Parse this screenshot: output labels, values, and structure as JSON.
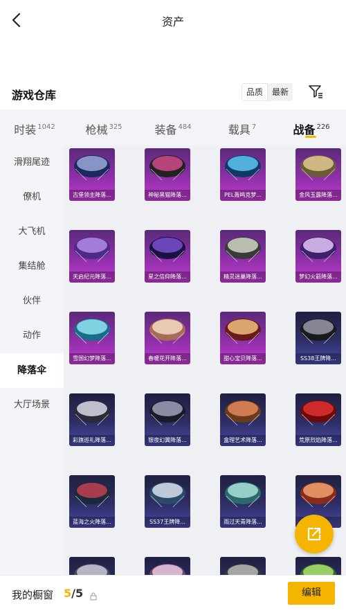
{
  "header": {
    "title": "资产"
  },
  "warehouse": {
    "title": "游戏仓库",
    "sort_quality": "品质",
    "sort_newest": "最新"
  },
  "tabs": [
    {
      "label": "时装",
      "count": "1042"
    },
    {
      "label": "枪械",
      "count": "325"
    },
    {
      "label": "装备",
      "count": "484"
    },
    {
      "label": "载具",
      "count": "7"
    },
    {
      "label": "战备",
      "count": "226"
    }
  ],
  "active_tab": "战备",
  "sidebar": [
    {
      "label": "滑翔尾迹"
    },
    {
      "label": "僚机"
    },
    {
      "label": "大飞机"
    },
    {
      "label": "集结舱"
    },
    {
      "label": "伙伴"
    },
    {
      "label": "动作"
    },
    {
      "label": "降落伞"
    },
    {
      "label": "大厅场景"
    }
  ],
  "active_sidebar": "降落伞",
  "items": [
    {
      "name": "古堡领主降落..."
    },
    {
      "name": "神秘黑猫降落..."
    },
    {
      "name": "PEL轰鸣克梦..."
    },
    {
      "name": "金风玉露降落..."
    },
    {
      "name": "天启纪元降落..."
    },
    {
      "name": "星之信仰降落..."
    },
    {
      "name": "精灵迷巢降落..."
    },
    {
      "name": "梦幻火箭降落..."
    },
    {
      "name": "雪国幻梦降落..."
    },
    {
      "name": "春暖花开降落..."
    },
    {
      "name": "甜心宝贝降落..."
    },
    {
      "name": "SS38王牌降..."
    },
    {
      "name": "彩旗巡礼降落..."
    },
    {
      "name": "银夜幻翼降落..."
    },
    {
      "name": "盒理艺术降落..."
    },
    {
      "name": "荒原烈焰降落..."
    },
    {
      "name": "蓝海之火降落..."
    },
    {
      "name": "SS37王牌降..."
    },
    {
      "name": "雨过天青降落..."
    },
    {
      "name": ""
    },
    {
      "name": ""
    },
    {
      "name": ""
    },
    {
      "name": ""
    },
    {
      "name": ""
    }
  ],
  "colors": {
    "accent": "#f5b400",
    "rarity_purple": "#9b2fb5",
    "rarity_blue": "#3b3b8c"
  },
  "bottom": {
    "label": "我的橱窗",
    "used": "5",
    "total": "/5",
    "edit_label": "编辑"
  }
}
